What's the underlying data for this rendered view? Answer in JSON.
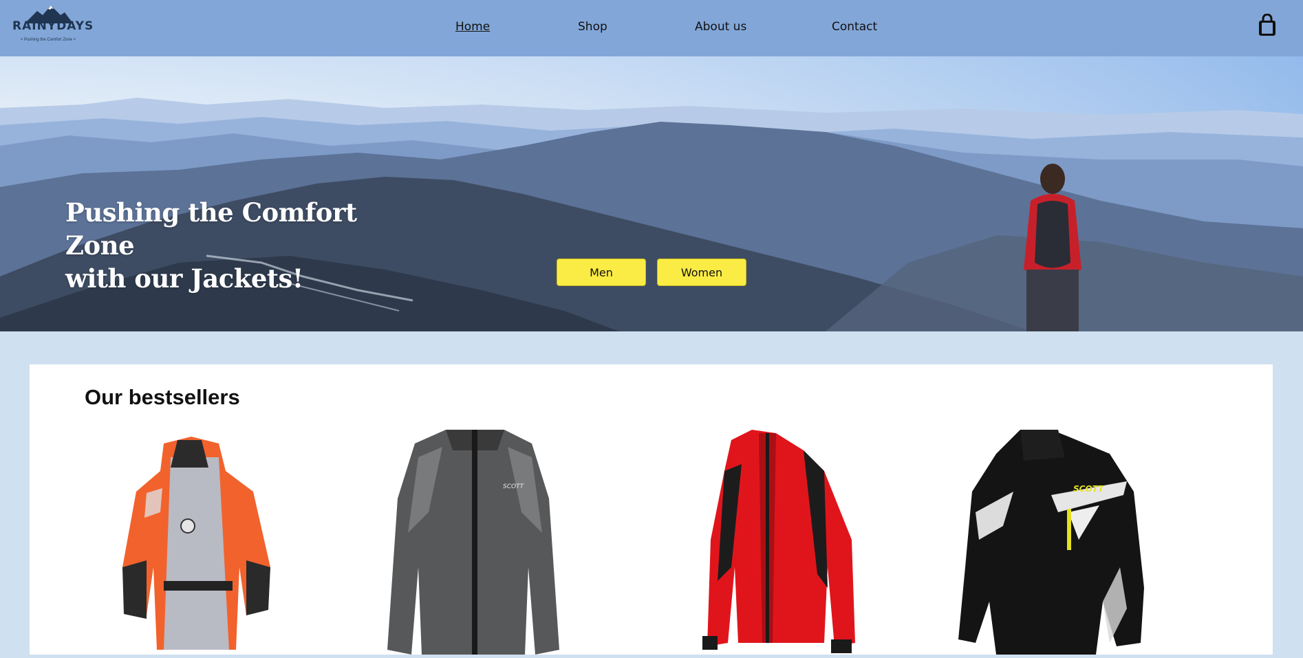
{
  "header": {
    "logo": {
      "wordmark": "RAINYDAYS",
      "tagline": "× Pushing the Comfort Zone ×"
    },
    "nav": [
      {
        "label": "Home",
        "active": true
      },
      {
        "label": "Shop",
        "active": false
      },
      {
        "label": "About us",
        "active": false
      },
      {
        "label": "Contact",
        "active": false
      }
    ],
    "cart_icon": "shopping-bag-icon"
  },
  "hero": {
    "title_line1": "Pushing the Comfort Zone",
    "title_line2": "with our Jackets!",
    "buttons": {
      "men": "Men",
      "women": "Women"
    },
    "button_color": "#fbec45"
  },
  "bestsellers": {
    "heading": "Our bestsellers",
    "products": [
      {
        "image": "orange-grey-float-jacket"
      },
      {
        "image": "grey-scott-windbreaker"
      },
      {
        "image": "red-black-cycling-jacket"
      },
      {
        "image": "black-scott-motocross-jacket"
      }
    ]
  },
  "colors": {
    "header_bg": "#82a6d7",
    "page_bg": "#cfe0f0",
    "panel_bg": "#ffffff"
  }
}
